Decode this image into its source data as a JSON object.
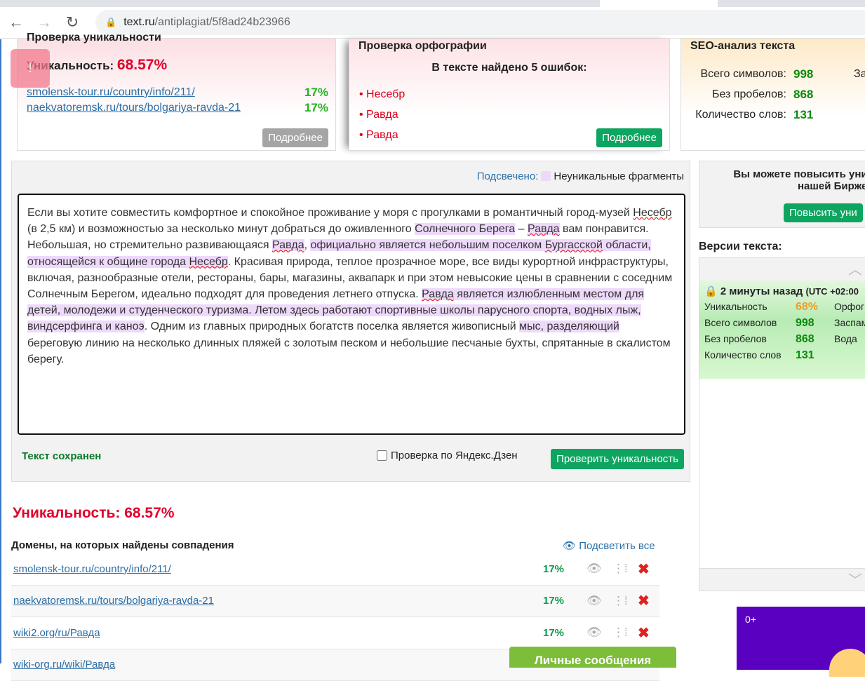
{
  "browser": {
    "url_host": "text.ru",
    "url_path": "/antiplagiat/5f8ad24b23966"
  },
  "uniq_card": {
    "title": "Проверка уникальности",
    "label": "Уникальность:",
    "value": "68.57%",
    "sources": [
      {
        "url": "smolensk-tour.ru/country/info/211/",
        "pct": "17%"
      },
      {
        "url": "naekvatoremsk.ru/tours/bolgariya-ravda-21",
        "pct": "17%"
      }
    ],
    "more": "Подробнее"
  },
  "spell_card": {
    "title": "Проверка орфографии",
    "found": "В тексте найдено 5 ошибок:",
    "errors": [
      "Несебр",
      "Равда",
      "Равда"
    ],
    "more": "Подробнее"
  },
  "seo_card": {
    "title": "SEO-анализ текста",
    "rows": [
      {
        "label": "Всего символов:",
        "value": "998"
      },
      {
        "label": "Без пробелов:",
        "value": "868"
      },
      {
        "label": "Количество слов:",
        "value": "131"
      }
    ],
    "cut": "За"
  },
  "pinned": "!",
  "editor": {
    "legend_key": "Подсвечено:",
    "legend_label": "Неуникальные фрагменты",
    "segments": [
      {
        "t": "Если вы хотите совместить комфортное и спокойное проживание у моря с прогулками в романтичный город-музей "
      },
      {
        "t": "Несебр",
        "e": true
      },
      {
        "t": " (в 2,5 км) и возможностью за несколько минут добраться до оживленного "
      },
      {
        "t": "Солнечного Берега",
        "h": true
      },
      {
        "t": " – "
      },
      {
        "t": "Равда",
        "h": true,
        "e": true
      },
      {
        "t": " вам понравится. Небольшая, но стремительно развивающаяся "
      },
      {
        "t": "Равда",
        "h": true,
        "e": true
      },
      {
        "t": ", "
      },
      {
        "t": "официально является небольшим поселком ",
        "h": true
      },
      {
        "t": "Бургасской",
        "h": true,
        "e": true
      },
      {
        "t": " области, относящейся к общине города ",
        "h": true
      },
      {
        "t": "Несебр",
        "h": true,
        "e": true
      },
      {
        "t": ". Красивая природа, теплое прозрачное море, все виды курортной инфраструктуры, включая, разнообразные отели, рестораны, бары, магазины, аквапарк и при этом невысокие цены в сравнении с соседним Солнечным Берегом, идеально подходят для проведения летнего отпуска. "
      },
      {
        "t": "Равда",
        "h": true,
        "e": true
      },
      {
        "t": " является излюбленным местом для детей, молодежи и студенческого туризма. Летом здесь работают спортивные школы парусного спорта, водных лыж, виндсерфинга и каноэ",
        "h": true
      },
      {
        "t": ". Одним из главных природных богатств поселка является живописный "
      },
      {
        "t": "мыс, разделяющий",
        "h": true
      },
      {
        "t": " береговую линию на несколько длинных пляжей с золотым песком и небольшие песчаные бухты, спрятанные в скалистом берегу."
      }
    ],
    "saved": "Текст сохранен",
    "yandex_zen": "Проверка по Яндекс.Дзен",
    "check_button": "Проверить уникальность"
  },
  "results": {
    "title": "Уникальность: 68.57%",
    "domains_heading": "Домены, на которых найдены совпадения",
    "highlight_all": "Подсветить все",
    "rows": [
      {
        "url": "smolensk-tour.ru/country/info/211/",
        "pct": "17%"
      },
      {
        "url": "naekvatoremsk.ru/tours/bolgariya-ravda-21",
        "pct": "17%"
      },
      {
        "url": "wiki2.org/ru/Равда",
        "pct": "17%"
      },
      {
        "url": "wiki-org.ru/wiki/Равда",
        "pct": ""
      }
    ]
  },
  "messages_button": "Личные сообщения",
  "promo": {
    "line1": "Вы можете повысить уни",
    "line2": "нашей Бирже р",
    "button": "Повысить уни"
  },
  "versions": {
    "title": "Версии текста:",
    "when": "2 минуты назад",
    "tz": "(UTC +02:00",
    "stats": [
      {
        "label": "Уникальность",
        "value": "68%",
        "side": "Орфог"
      },
      {
        "label": "Всего символов",
        "value": "998",
        "side": "Заспам"
      },
      {
        "label": "Без пробелов",
        "value": "868",
        "side": "Вода"
      },
      {
        "label": "Количество слов",
        "value": "131",
        "side": ""
      }
    ]
  },
  "ad": {
    "age": "0+"
  },
  "colors": {
    "accent_green": "#0ea560",
    "red": "#e0002a",
    "highlight": "#eed9fb"
  }
}
